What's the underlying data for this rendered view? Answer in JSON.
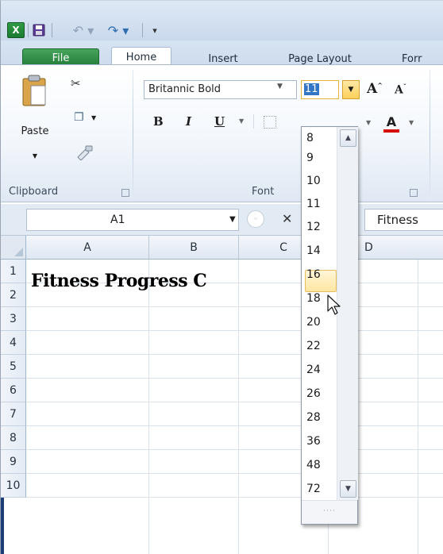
{
  "app": {
    "logo_letter": "X"
  },
  "quick_access": {
    "undo_glyph": "↶ ▾",
    "redo_glyph": "↷ ▾",
    "customize_glyph": "▾"
  },
  "tabs": [
    {
      "label": "File",
      "active": false
    },
    {
      "label": "Home",
      "active": true
    },
    {
      "label": "Insert",
      "active": false
    },
    {
      "label": "Page Layout",
      "active": false
    },
    {
      "label": "Forr",
      "active": false
    }
  ],
  "clipboard": {
    "paste_label": "Paste",
    "group_label": "Clipboard"
  },
  "font": {
    "name": "Britannic Bold",
    "size": "11",
    "group_label": "Font",
    "bold": "B",
    "italic": "I",
    "underline": "U",
    "font_color_letter": "A",
    "grow": "A",
    "shrink": "A",
    "font_color": "#d50d0d"
  },
  "formula_bar": {
    "name_box": "A1",
    "cancel_glyph": "✕",
    "formula_partial": "Fitness"
  },
  "grid": {
    "columns": [
      "A",
      "B",
      "C",
      "D"
    ],
    "rows": [
      "1",
      "2",
      "3",
      "4",
      "5",
      "6",
      "7",
      "8",
      "9",
      "10"
    ],
    "a1_text": "Fitness Progress C"
  },
  "size_dropdown": {
    "options": [
      "8",
      "9",
      "10",
      "11",
      "12",
      "14",
      "16",
      "18",
      "20",
      "22",
      "24",
      "26",
      "28",
      "36",
      "48",
      "72"
    ],
    "hovered": "16",
    "grip": "····"
  },
  "colors": {
    "accent_file_tab": "#1f7a36",
    "highlight": "#ffe6a2",
    "ribbon_border": "#a7bad1"
  }
}
